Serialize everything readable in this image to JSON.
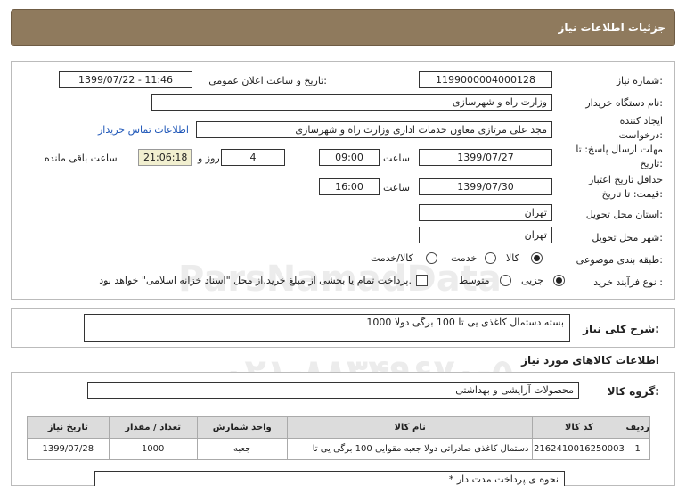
{
  "header": {
    "title": "جزئیات اطلاعات نیاز"
  },
  "form": {
    "need_number_label": "شماره نیاز:",
    "need_number": "1199000004000128",
    "announce_label": "تاریخ و ساعت اعلان عمومی:",
    "announce_value": "1399/07/22 - 11:46",
    "buyer_org_label": "نام دستگاه خریدار:",
    "buyer_org": "وزارت راه و شهرسازی",
    "creator_label": "ایجاد کننده درخواست:",
    "creator": "مجد علی  مرتازی معاون خدمات اداری وزارت راه و شهرسازی",
    "contact_link": "اطلاعات تماس خریدار",
    "send_deadline_label": "مهلت ارسال پاسخ: تا تاریخ:",
    "send_date": "1399/07/27",
    "time_label": "ساعت",
    "send_time": "09:00",
    "days_value": "4",
    "days_label": "روز و",
    "remaining_time": "21:06:18",
    "remaining_label": "ساعت باقی مانده",
    "validity_label": "حداقل تاریخ اعتبار قیمت: تا تاریخ:",
    "validity_date": "1399/07/30",
    "validity_time_label": "ساعت",
    "validity_time": "16:00",
    "province_label": "استان محل تحویل:",
    "province": "تهران",
    "city_label": "شهر محل تحویل:",
    "city": "تهران",
    "category_label": "طبقه بندی موضوعی:",
    "category_options": [
      "کالا",
      "خدمت",
      "کالا/خدمت"
    ],
    "process_label": "نوع فرآیند خرید :",
    "process_options": [
      "جزیی",
      "متوسط"
    ],
    "payment_note": "پرداخت تمام یا بخشی از مبلغ خرید،از محل \"اسناد خزانه اسلامی\" خواهد بود."
  },
  "summary": {
    "label": "شرح کلی نیاز:",
    "value": "1000 بسته دستمال کاغذی یی تا 100 برگی دولا"
  },
  "goods_section_title": "اطلاعات کالاهای مورد نیاز",
  "goods_group": {
    "label": "گروه کالا:",
    "value": "محصولات آرایشی و بهداشتی"
  },
  "table": {
    "headers": [
      "ردیف",
      "کد کالا",
      "نام کالا",
      "واحد شمارش",
      "تعداد / مقدار",
      "تاریخ نیاز"
    ],
    "rows": [
      [
        "1",
        "2162410016250003",
        "دستمال کاغذی صادراتی دولا جعبه مقوایی 100 برگی یی تا",
        "جعبه",
        "1000",
        "1399/07/28"
      ]
    ]
  },
  "notes": {
    "line1": "* نحوه ی پرداخت مدت دار"
  },
  "watermark": {
    "brand": "ParsNamadData",
    "phone": "۰۲۱-۸۸۳۴۹۶۷۰-۵",
    "tagline": "پایگاه اطلاع رسانی مناقصه و مزایده"
  },
  "colors": {
    "title_bar": "#8f7a5d",
    "link": "#1f57b8",
    "timer_bg": "#f1efcf"
  }
}
